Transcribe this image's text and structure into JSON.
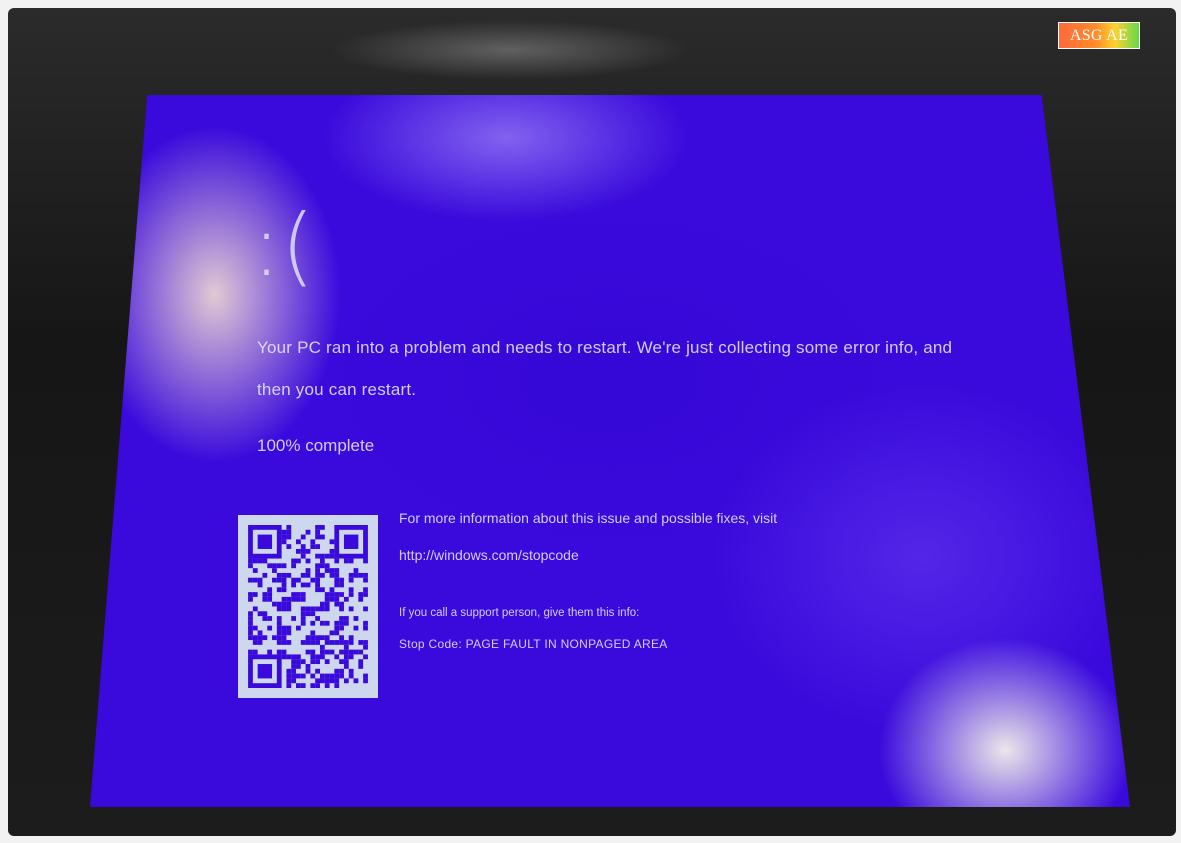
{
  "tag": {
    "text": "ASG AE"
  },
  "bsod": {
    "face": ":(",
    "message": "Your PC ran into a problem and needs to restart. We're just collecting some error info, and then you can restart.",
    "progress_text": "100% complete",
    "more_info": "For more information about this issue and possible fixes, visit",
    "url": "http://windows.com/stopcode",
    "support": "If you call a support person, give them this info:",
    "stop_code": "Stop Code: PAGE FAULT IN NONPAGED AREA"
  },
  "colors": {
    "screen_blue": "#3a0adc",
    "text": "#e6e6ff",
    "qr_background": "#cdd7ee",
    "qr_modules": "#3a0adc"
  },
  "icons": [
    "qr-code-icon"
  ]
}
